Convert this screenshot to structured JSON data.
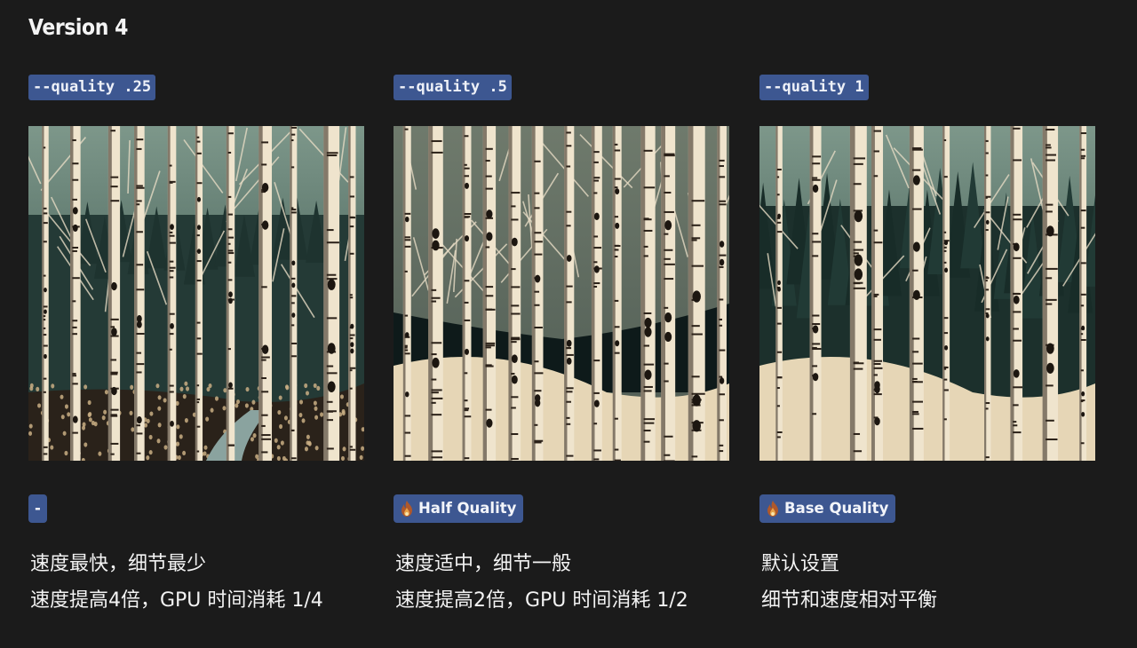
{
  "page": {
    "title": "Version 4"
  },
  "columns": [
    {
      "param": "--quality .25",
      "image_alt": "Woodcut-style birch forest with path, low detail",
      "badge": {
        "label": "-",
        "icon": "none"
      },
      "lines": [
        "速度最快，细节最少",
        "速度提高4倍，GPU 时间消耗 1/4"
      ]
    },
    {
      "param": "--quality .5",
      "image_alt": "Woodcut-style birch forest in snow, medium detail",
      "badge": {
        "label": "Half Quality",
        "icon": "fire-icon"
      },
      "lines": [
        "速度适中，细节一般",
        "速度提高2倍，GPU 时间消耗 1/2"
      ]
    },
    {
      "param": "--quality 1",
      "image_alt": "Woodcut-style birch forest with pines, base detail",
      "badge": {
        "label": "Base Quality",
        "icon": "fire-icon"
      },
      "lines": [
        "默认设置",
        "细节和速度相对平衡"
      ]
    }
  ],
  "colors": {
    "background": "#1b1b1b",
    "tag_background": "#3d5791",
    "text": "#f3f3f3"
  }
}
